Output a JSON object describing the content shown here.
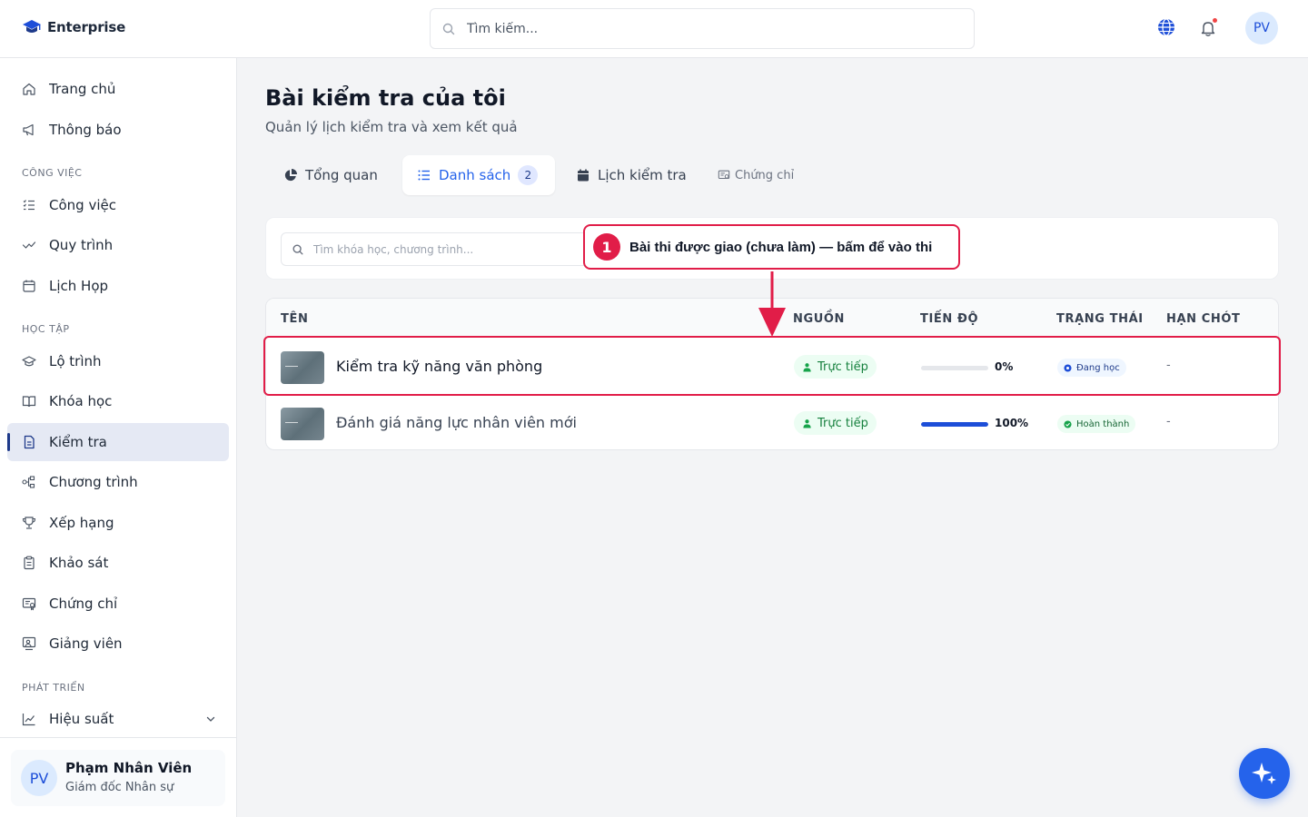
{
  "header": {
    "brand": "Enterprise",
    "search_placeholder": "Tìm kiếm...",
    "avatar_initials": "PV"
  },
  "sidebar": {
    "items_top": [
      {
        "label": "Trang chủ",
        "icon": "home-icon"
      },
      {
        "label": "Thông báo",
        "icon": "megaphone-icon"
      }
    ],
    "section_work": "CÔNG VIỆC",
    "items_work": [
      {
        "label": "Công việc",
        "icon": "tasks-icon"
      },
      {
        "label": "Quy trình",
        "icon": "workflow-icon"
      },
      {
        "label": "Lịch Họp",
        "icon": "calendar-icon"
      }
    ],
    "section_learning": "HỌC TẬP",
    "items_learning": [
      {
        "label": "Lộ trình",
        "icon": "graduation-cap-icon"
      },
      {
        "label": "Khóa học",
        "icon": "book-icon"
      },
      {
        "label": "Kiểm tra",
        "icon": "document-icon",
        "active": true
      },
      {
        "label": "Chương trình",
        "icon": "program-icon"
      },
      {
        "label": "Xếp hạng",
        "icon": "trophy-icon"
      },
      {
        "label": "Khảo sát",
        "icon": "clipboard-icon"
      },
      {
        "label": "Chứng chỉ",
        "icon": "certificate-icon"
      },
      {
        "label": "Giảng viên",
        "icon": "instructor-icon"
      }
    ],
    "section_growth": "PHÁT TRIỂN",
    "items_growth": [
      {
        "label": "Hiệu suất",
        "icon": "chart-line-icon"
      }
    ],
    "user": {
      "initials": "PV",
      "name": "Phạm Nhân Viên",
      "role": "Giám đốc Nhân sự"
    }
  },
  "main": {
    "title": "Bài kiểm tra của tôi",
    "subtitle": "Quản lý lịch kiểm tra và xem kết quả",
    "tabs": [
      {
        "label": "Tổng quan",
        "icon": "pie-chart-icon"
      },
      {
        "label": "Danh sách",
        "icon": "list-icon",
        "badge": "2",
        "active": true
      },
      {
        "label": "Lịch kiểm tra",
        "icon": "calendar-icon"
      },
      {
        "label": "Chứng chỉ",
        "icon": "certificate-icon"
      }
    ],
    "filter_placeholder": "Tìm khóa học, chương trình...",
    "table": {
      "columns": [
        "TÊN",
        "NGUỒN",
        "TIẾN ĐỘ",
        "TRẠNG THÁI",
        "HẠN CHÓT"
      ],
      "rows": [
        {
          "name": "Kiểm tra kỹ năng văn phòng",
          "source": "Trực tiếp",
          "progress": 0,
          "progress_label": "0%",
          "status": "Đang học",
          "deadline": "-"
        },
        {
          "name": "Đánh giá năng lực nhân viên mới",
          "source": "Trực tiếp",
          "progress": 100,
          "progress_label": "100%",
          "status": "Hoàn thành",
          "deadline": "-"
        }
      ]
    }
  },
  "annotation": {
    "number": "1",
    "text": "Bài thi được giao (chưa làm) — bấm để vào thi"
  },
  "colors": {
    "accent": "#2563eb",
    "annotation": "#e11d48",
    "success": "#15803d"
  }
}
